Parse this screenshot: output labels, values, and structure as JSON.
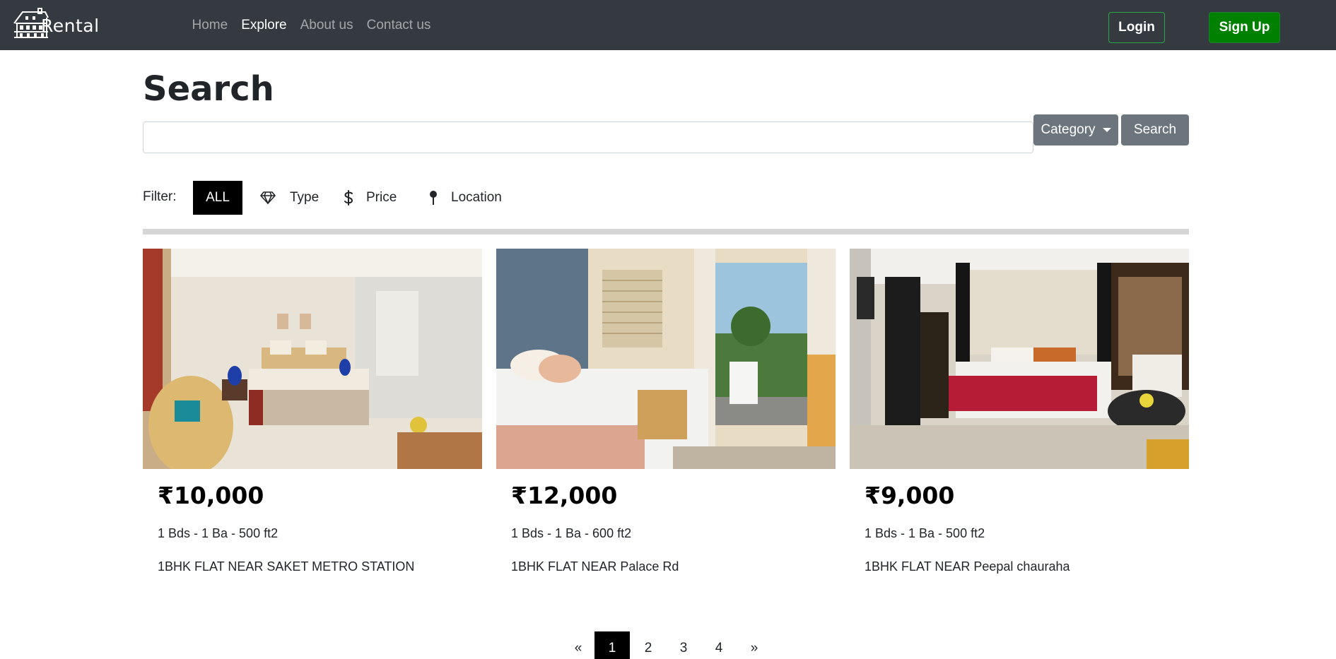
{
  "navbar": {
    "brand": "Rental",
    "brand_icon": "house-logo-icon",
    "links": [
      {
        "label": "Home",
        "active": false
      },
      {
        "label": "Explore",
        "active": true
      },
      {
        "label": "About us",
        "active": false
      },
      {
        "label": "Contact us",
        "active": false
      }
    ],
    "login_label": "Login",
    "signup_label": "Sign Up"
  },
  "search": {
    "title": "Search",
    "input_value": "",
    "placeholder": "",
    "category_label": "Category",
    "search_label": "Search"
  },
  "filter": {
    "label": "Filter:",
    "all_label": "ALL",
    "items": [
      {
        "label": "Type",
        "icon": "diamond-icon"
      },
      {
        "label": "Price",
        "icon": "dollar-icon"
      },
      {
        "label": "Location",
        "icon": "map-pin-icon"
      }
    ]
  },
  "listings": [
    {
      "price": "₹10,000",
      "specs": "1 Bds - 1 Ba - 500 ft2",
      "title": "1BHK FLAT NEAR SAKET METRO STATION",
      "image": "bedroom-photo"
    },
    {
      "price": "₹12,000",
      "specs": "1 Bds - 1 Ba - 600 ft2",
      "title": "1BHK FLAT NEAR Palace Rd",
      "image": "bedroom-photo"
    },
    {
      "price": "₹9,000",
      "specs": "1 Bds - 1 Ba - 500 ft2",
      "title": "1BHK FLAT NEAR Peepal chauraha",
      "image": "bedroom-photo"
    }
  ],
  "pagination": {
    "prev": "«",
    "pages": [
      "1",
      "2",
      "3",
      "4"
    ],
    "current": "1",
    "next": "»"
  },
  "colors": {
    "navbar_bg": "#343a40",
    "signup_bg": "#008000",
    "login_border": "#28a745",
    "secondary_btn": "#6c757d",
    "active_filter": "#000000"
  }
}
